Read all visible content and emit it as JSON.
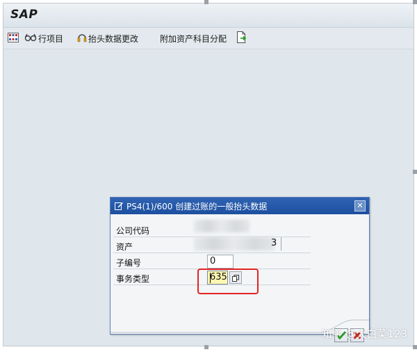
{
  "app": {
    "logo": "SAP"
  },
  "toolbar": {
    "line_items_label": "行项目",
    "header_change_label": "抬头数据更改",
    "assign_label": "附加资产科目分配"
  },
  "dialog": {
    "title": "PS4(1)/600 创建过账的一般抬头数据",
    "fields": {
      "company_code_label": "公司代码",
      "asset_label": "资产",
      "asset_value_suffix": "3",
      "sub_number_label": "子编号",
      "sub_number_value": "0",
      "transaction_type_label": "事务类型",
      "transaction_type_value": "635"
    }
  },
  "watermark": "知乎 @大白菜123",
  "colors": {
    "title_bar": "#1d4f9f",
    "highlight": "#e32222",
    "ok_green": "#2e9d2e",
    "cancel_red": "#cc2a1f",
    "focus_field": "#fff7b0"
  }
}
